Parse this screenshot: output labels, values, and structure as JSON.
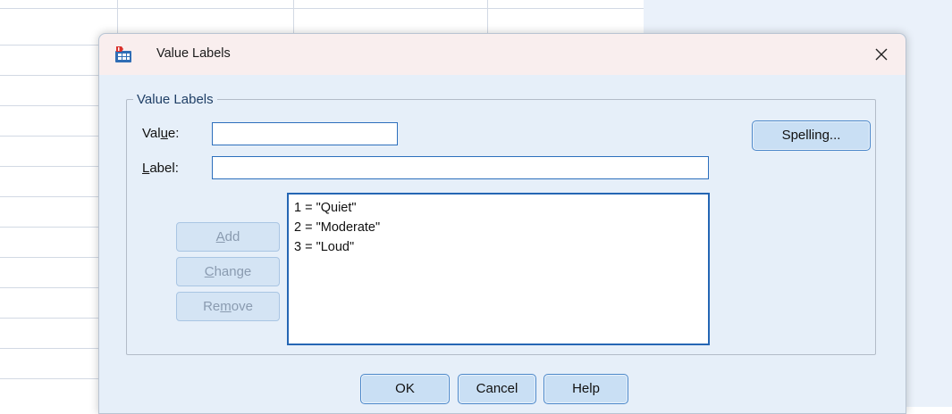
{
  "dialog": {
    "title": "Value Labels",
    "icon": "spss-value-labels-icon",
    "close_icon": "close-icon"
  },
  "group": {
    "label": "Value Labels"
  },
  "value_field": {
    "label_prefix": "Val",
    "label_mnemonic": "u",
    "label_suffix": "e:",
    "value": ""
  },
  "label_field": {
    "label_prefix": "",
    "label_mnemonic": "L",
    "label_suffix": "abel:",
    "value": ""
  },
  "buttons": {
    "spelling": "Spelling...",
    "add": {
      "prefix": "",
      "mnemonic": "A",
      "suffix": "dd"
    },
    "change": {
      "prefix": "",
      "mnemonic": "C",
      "suffix": "hange"
    },
    "remove": {
      "prefix": "Re",
      "mnemonic": "m",
      "suffix": "ove"
    },
    "ok": "OK",
    "cancel": "Cancel",
    "help": "Help"
  },
  "value_labels_list": [
    "1 = \"Quiet\"",
    "2 = \"Moderate\"",
    "3 = \"Loud\""
  ],
  "colors": {
    "accent": "#2566b4",
    "button_bg": "#c9dff4",
    "disabled_text": "#8a9bb0",
    "dialog_bg": "#e6eff9",
    "titlebar_bg": "#f9eeee"
  }
}
